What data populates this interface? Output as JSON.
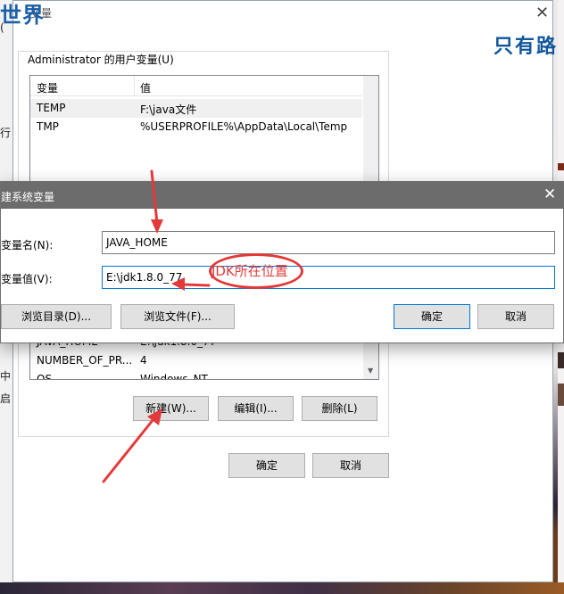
{
  "brand": {
    "left": "世界",
    "right": "只有路"
  },
  "env_window": {
    "title": "变量",
    "close_glyph": "✕",
    "user_group_label": "Administrator 的用户变量(U)",
    "columns": [
      "变量",
      "值"
    ],
    "user_vars": [
      {
        "name": "TEMP",
        "value": "F:\\java文件"
      },
      {
        "name": "TMP",
        "value": "%USERPROFILE%\\AppData\\Local\\Temp"
      }
    ],
    "system_vars_visible": [
      {
        "name": "JAVA_HOME",
        "value": "E:\\jdk1.8.0_77"
      },
      {
        "name": "NUMBER_OF_PR...",
        "value": "4"
      },
      {
        "name": "OS",
        "value": "Windows_NT"
      }
    ],
    "buttons": {
      "new": "新建(W)...",
      "edit": "编辑(I)...",
      "delete": "删除(L)"
    },
    "ok": "确定",
    "cancel": "取消",
    "left_edge_chars": [
      "(",
      "行",
      "中",
      "启"
    ]
  },
  "new_var_dialog": {
    "title": "建系统变量",
    "close_glyph": "✕",
    "name_label": "变量名(N):",
    "name_value": "JAVA_HOME",
    "value_label": "变量值(V):",
    "value_value": "E:\\jdk1.8.0_77",
    "browse_dir": "浏览目录(D)...",
    "browse_file": "浏览文件(F)...",
    "ok": "确定",
    "cancel": "取消"
  },
  "annotation": {
    "text": "JDK所在位置",
    "color": "#e23a3a"
  },
  "colors": {
    "accent": "#0078d7",
    "titlebar": "#6c6c6c",
    "annotation_red": "#e23a3a"
  }
}
